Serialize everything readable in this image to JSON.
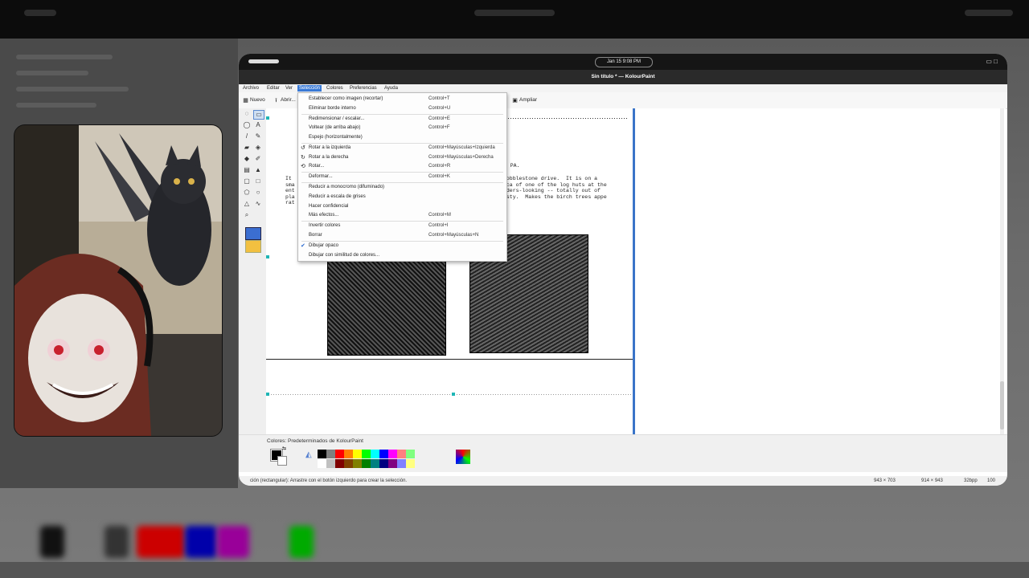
{
  "window": {
    "clock": "Jan 15   9:08 PM",
    "title": "Sin título * — KolourPaint"
  },
  "menubar": {
    "items": [
      "Archivo",
      "Editar",
      "Ver",
      "Selección",
      "Colores",
      "Preferencias",
      "Ayuda"
    ],
    "active": "Selección"
  },
  "toolbar": {
    "new_label": "Nuevo",
    "open_label": "Abrir...",
    "zoom_label": "Ampliar"
  },
  "selection_menu": {
    "items": [
      {
        "label": "Establecer como imagen (recortar)",
        "shortcut": "Control+T"
      },
      {
        "label": "Eliminar borde interno",
        "shortcut": "Control+U"
      },
      {
        "label": "Redimensionar / escalar...",
        "shortcut": "Control+E"
      },
      {
        "label": "Voltear (de arriba abajo)",
        "shortcut": "Control+F"
      },
      {
        "label": "Espejo (horizontalmente)",
        "shortcut": ""
      },
      {
        "label": "Rotar a la izquierda",
        "shortcut": "Control+Mayúsculas+Izquierda",
        "icon": "rotate-left-icon"
      },
      {
        "label": "Rotar a la derecha",
        "shortcut": "Control+Mayúsculas+Derecha",
        "icon": "rotate-right-icon"
      },
      {
        "label": "Rotar...",
        "shortcut": "Control+R",
        "icon": "rotate-icon"
      },
      {
        "label": "Deformar...",
        "shortcut": "Control+K"
      },
      {
        "label": "Reducir a monocromo (difuminado)",
        "shortcut": ""
      },
      {
        "label": "Reducir a escala de grises",
        "shortcut": ""
      },
      {
        "label": "Hacer confidencial",
        "shortcut": ""
      },
      {
        "label": "Más efectos...",
        "shortcut": "Control+M"
      },
      {
        "label": "Invertir colores",
        "shortcut": "Control+I"
      },
      {
        "label": "Borrar",
        "shortcut": "Control+Mayúsculas+N"
      },
      {
        "label": "Dibujar opaco",
        "shortcut": "",
        "checked": true
      },
      {
        "label": "Dibujar con similitud de colores...",
        "shortcut": ""
      }
    ]
  },
  "document": {
    "line_heading": "E, PA.",
    "text_left": "It\nsma\nent\npla\nrat",
    "text_right": "cobblestone drive.  It is on a\nica of one of the log huts at the\noders-looking -- totally out of\nisty.  Makes the birch trees appe"
  },
  "colors_panel": {
    "label": "Colores: Predeterminados de KolourPaint",
    "palette_top": [
      "#000000",
      "#808080",
      "#ff0000",
      "#ff8000",
      "#ffff00",
      "#00ff00",
      "#00ffff",
      "#0000ff",
      "#ff00ff",
      "#ff8080",
      "#80ff80"
    ],
    "palette_bottom": [
      "#ffffff",
      "#c0c0c0",
      "#800000",
      "#804000",
      "#808000",
      "#008000",
      "#008080",
      "#000080",
      "#800080",
      "#8080ff",
      "#ffff80"
    ]
  },
  "statusbar": {
    "hint": "ción (rectangular): Arrastre con el botón izquierdo para crear la selección.",
    "size1": "943 × 703",
    "size2": "914 × 943",
    "depth": "32bpp",
    "zoom": "100"
  }
}
